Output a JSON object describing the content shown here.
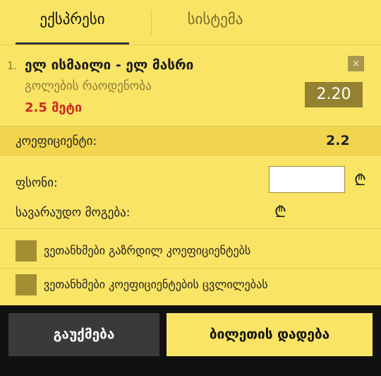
{
  "tabs": [
    {
      "label": "ექსპრესი",
      "active": true
    },
    {
      "label": "სისტემა",
      "active": false
    }
  ],
  "bet": {
    "index": "1.",
    "match": "ელ ისმაილი - ელ მასრი",
    "market": "გოლების რაოდენობა",
    "pick": "2.5 მეტი",
    "odds": "2.20",
    "remove_icon": "×"
  },
  "coefficient": {
    "label": "კოეფიციენტი:",
    "value": "2.2"
  },
  "stake": {
    "label": "ფსონი:",
    "value": "",
    "currency_icon": "₾"
  },
  "potential_win": {
    "label": "სავარაუდო მოგება:",
    "currency_icon": "₾"
  },
  "options": [
    {
      "label": "ვეთანხმები გაზრდილ კოეფიციენტებს"
    },
    {
      "label": "ვეთანხმები კოეფიციენტების ცვლილებას"
    }
  ],
  "actions": {
    "cancel": "გაუქმება",
    "place": "ბილეთის დადება"
  },
  "colors": {
    "background": "#fae465",
    "odds_box": "#94812f",
    "pick_text": "#c9291f",
    "checkbox": "#a38e34",
    "cancel_button": "#3a3a3a"
  }
}
